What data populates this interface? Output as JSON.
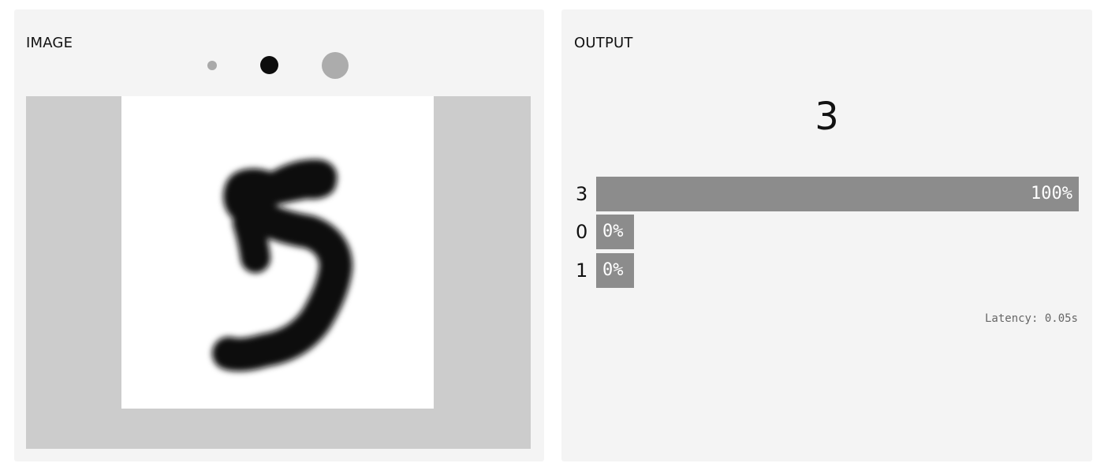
{
  "input": {
    "label": "IMAGE",
    "brushes": [
      {
        "name": "small-brush",
        "color": "#a9a9a9"
      },
      {
        "name": "medium-brush",
        "color": "#0d0d0d"
      },
      {
        "name": "large-brush",
        "color": "#acacac"
      }
    ],
    "drawn_content": "handwritten digit 5"
  },
  "output": {
    "label": "OUTPUT",
    "top_prediction": "3",
    "confidences": [
      {
        "label": "3",
        "value": 1.0,
        "text": "100%"
      },
      {
        "label": "0",
        "value": 0.0,
        "text": "0%"
      },
      {
        "label": "1",
        "value": 0.0,
        "text": "0%"
      }
    ],
    "latency": "Latency: 0.05s"
  },
  "colors": {
    "panel_bg": "#f4f4f4",
    "canvas_bg": "#cccccc",
    "bar": "#8c8c8c",
    "ink": "#0a0a0a"
  }
}
